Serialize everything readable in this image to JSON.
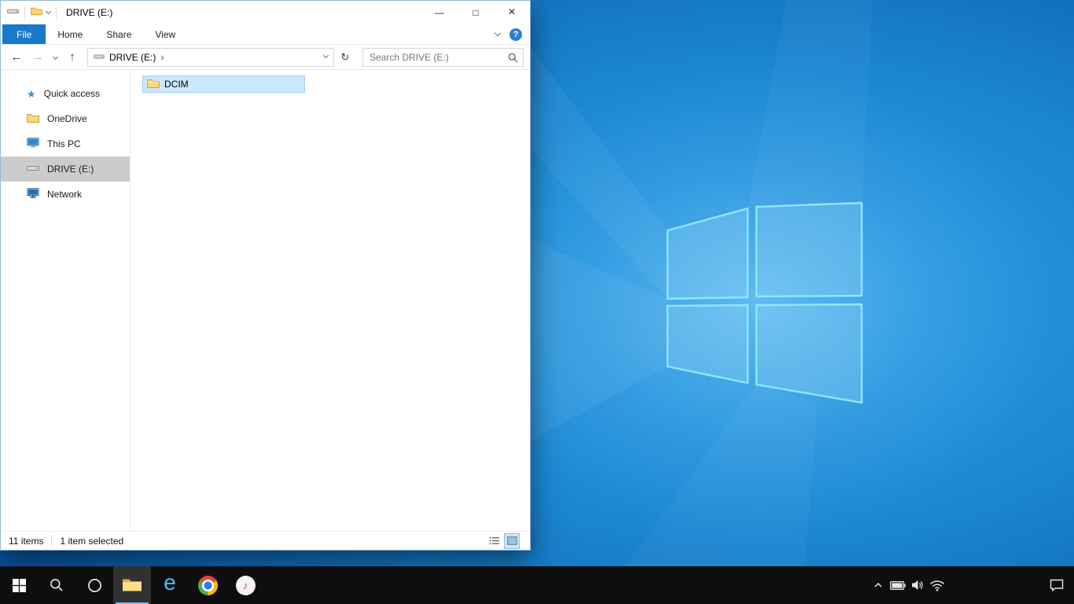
{
  "explorer": {
    "titlebar": {
      "title": "DRIVE (E:)"
    },
    "ribbon": {
      "tabs": [
        {
          "label": "File",
          "active": true
        },
        {
          "label": "Home",
          "active": false
        },
        {
          "label": "Share",
          "active": false
        },
        {
          "label": "View",
          "active": false
        }
      ],
      "help": "?"
    },
    "navbar": {
      "breadcrumb_drive": "DRIVE (E:)",
      "breadcrumb_separator": "›",
      "search_placeholder": "Search DRIVE (E:)"
    },
    "sidebar": {
      "items": [
        {
          "label": "Quick access",
          "icon": "star-icon"
        },
        {
          "label": "OneDrive",
          "icon": "onedrive-icon"
        },
        {
          "label": "This PC",
          "icon": "this-pc-icon"
        },
        {
          "label": "DRIVE (E:)",
          "icon": "drive-icon",
          "selected": true
        },
        {
          "label": "Network",
          "icon": "network-icon"
        }
      ]
    },
    "content": {
      "items": [
        {
          "label": "DCIM",
          "icon": "folder-icon",
          "selected": true
        }
      ]
    },
    "statusbar": {
      "count": "11 items",
      "selection": "1 item selected"
    }
  },
  "icons": {
    "back": "←",
    "forward": "→",
    "up": "↑",
    "refresh": "↻",
    "minimize": "—",
    "maximize": "□",
    "close": "×",
    "star": "★",
    "music_note": "♪",
    "ie_letter": "e"
  },
  "taskbar": {
    "items": [
      {
        "name": "start"
      },
      {
        "name": "search"
      },
      {
        "name": "cortana"
      },
      {
        "name": "file-explorer",
        "active": true
      },
      {
        "name": "internet-explorer"
      },
      {
        "name": "chrome"
      },
      {
        "name": "itunes"
      }
    ],
    "tray": [
      {
        "name": "hidden-icons-chevron"
      },
      {
        "name": "battery"
      },
      {
        "name": "volume"
      },
      {
        "name": "network"
      },
      {
        "name": "action-center"
      }
    ]
  },
  "colors": {
    "file_tab_bg": "#1979ca",
    "selection_bg": "#cce8ff",
    "selection_border": "#99d1ff",
    "sidebar_selected_bg": "#cccccc",
    "taskbar_bg": "#0e0e0e",
    "taskbar_active_underline": "#76b9ed",
    "wallpaper_base": "#0b5cab"
  }
}
